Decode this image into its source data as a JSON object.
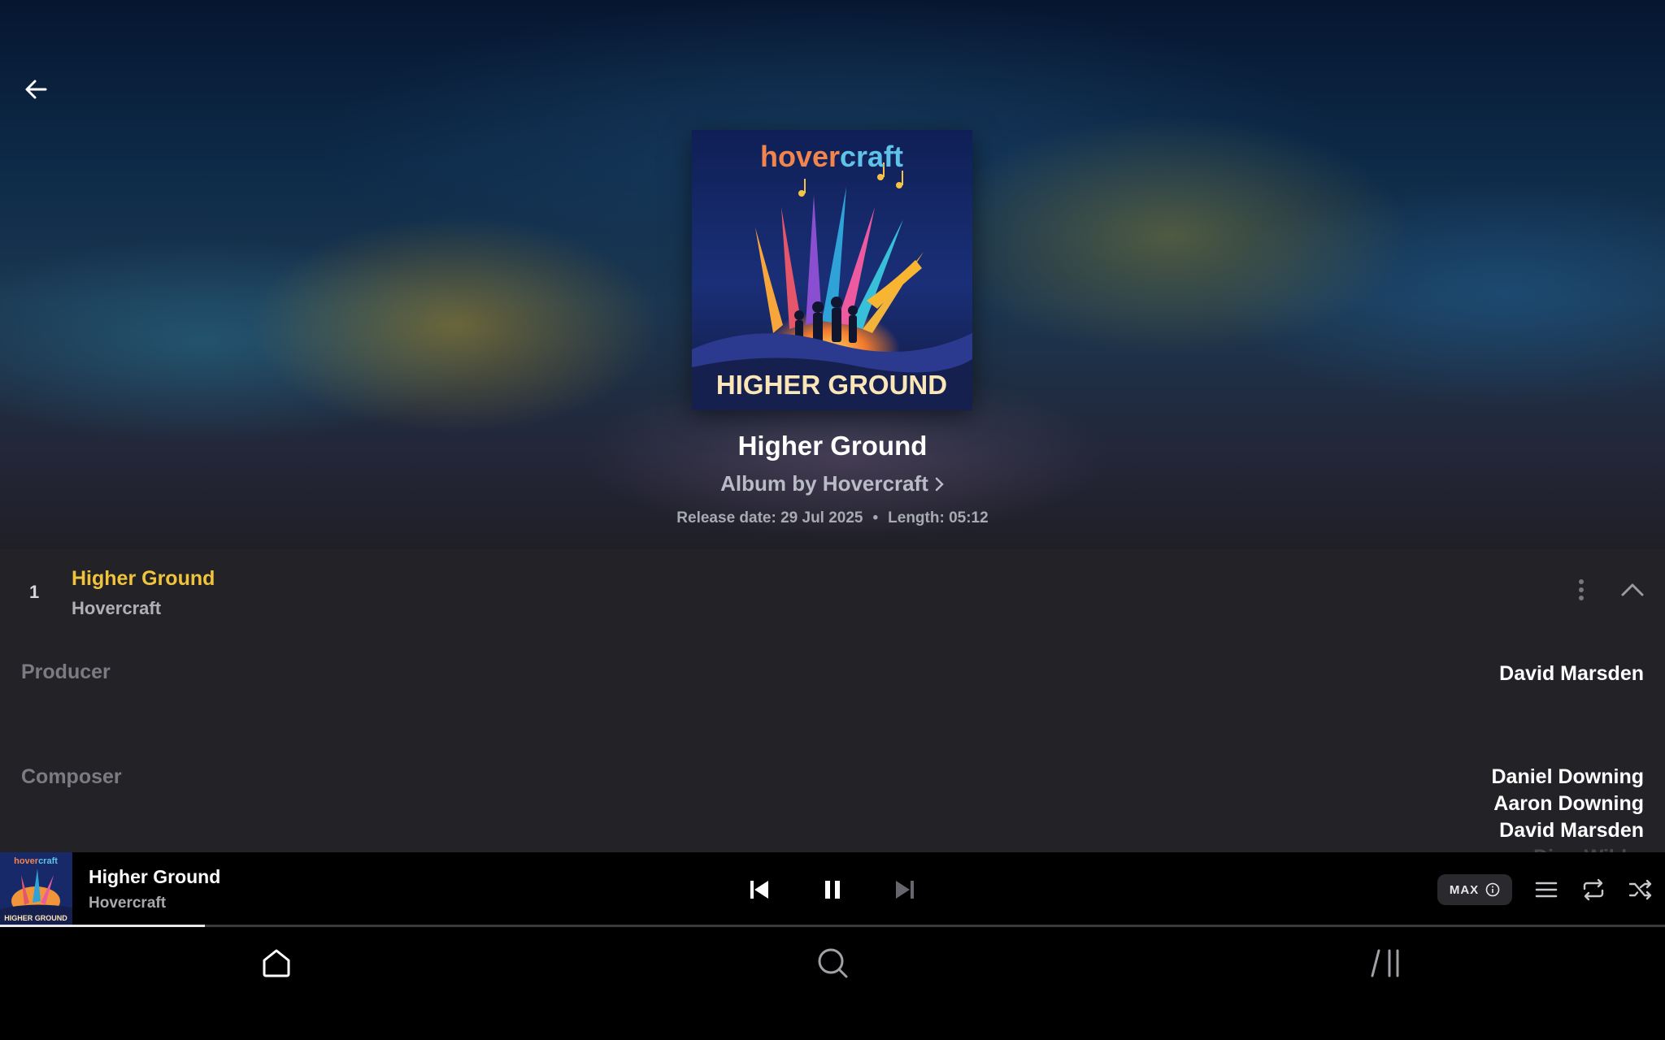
{
  "album": {
    "title": "Higher Ground",
    "subtitle": "Album by Hovercraft",
    "release_label": "Release date: 29 Jul 2025",
    "length_label": "Length: 05:12",
    "cover": {
      "logo_text_a": "hover",
      "logo_text_b": "craft",
      "cover_title": "HIGHER GROUND"
    }
  },
  "track": {
    "number": "1",
    "title": "Higher Ground",
    "artist": "Hovercraft"
  },
  "credits": {
    "producer_label": "Producer",
    "producer_value": "David Marsden",
    "composer_label": "Composer",
    "composers": [
      "Daniel Downing",
      "Aaron Downing",
      "David Marsden",
      "Dino Wild..."
    ]
  },
  "player": {
    "title": "Higher Ground",
    "artist": "Hovercraft",
    "quality_badge": "MAX",
    "progress_fraction": 0.123
  },
  "icons": {
    "back": "arrow-left-icon",
    "more": "more-vertical-icon",
    "collapse": "chevron-up-icon",
    "previous": "skip-previous-icon",
    "pause": "pause-icon",
    "next": "skip-next-icon",
    "info": "info-icon",
    "queue": "queue-list-icon",
    "repeat": "repeat-icon",
    "shuffle": "shuffle-icon",
    "home": "home-icon",
    "search": "search-icon",
    "library": "library-icon"
  },
  "colors": {
    "accent": "#f1c33c",
    "panel_bg": "#222227",
    "muted_label": "#7b7b82"
  }
}
